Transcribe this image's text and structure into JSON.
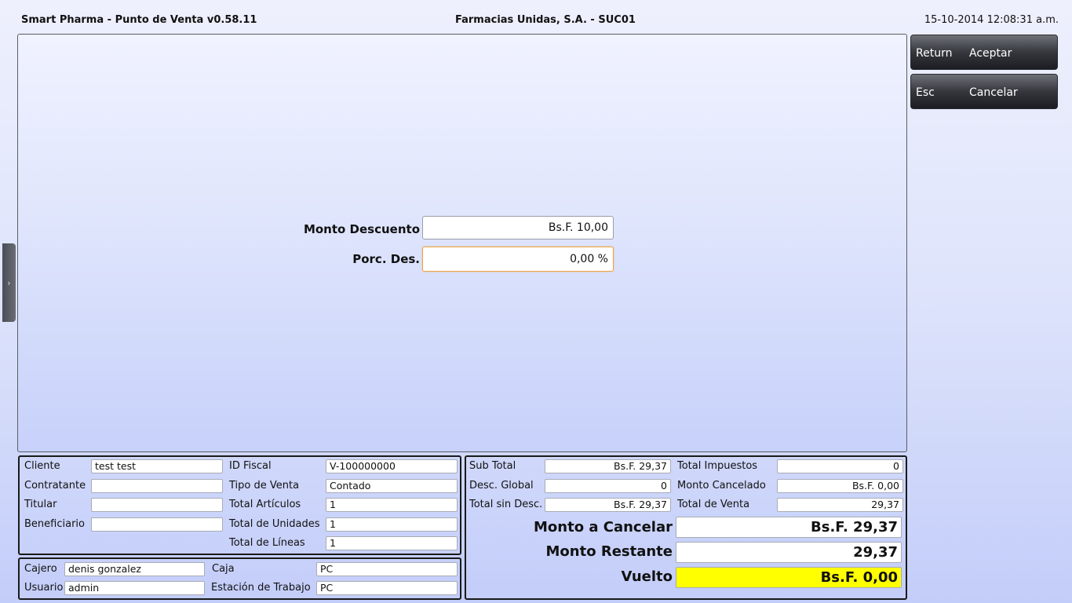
{
  "header": {
    "app_title": "Smart Pharma - Punto de Venta  v0.58.11",
    "company": "Farmacias Unidas, S.A.   -   SUC01",
    "datetime": "15-10-2014 12:08:31 a.m."
  },
  "discount_form": {
    "monto_label": "Monto Descuento",
    "monto_value": "Bs.F. 10,00",
    "porc_label": "Porc. Des.",
    "porc_value": "0,00 %"
  },
  "side_tab": {
    "icon": "chevron-right-icon",
    "glyph": "›"
  },
  "actions": [
    {
      "key": "Return",
      "label": "Aceptar"
    },
    {
      "key": "Esc",
      "label": "Cancelar"
    }
  ],
  "client_info": {
    "cliente_label": "Cliente",
    "cliente": "test test",
    "contratante_label": "Contratante",
    "contratante": "",
    "titular_label": "Titular",
    "titular": "",
    "beneficiario_label": "Beneficiario",
    "beneficiario": "",
    "id_fiscal_label": "ID Fiscal",
    "id_fiscal": "V-100000000",
    "tipo_venta_label": "Tipo de Venta",
    "tipo_venta": "Contado",
    "total_articulos_label": "Total Artículos",
    "total_articulos": "1",
    "total_unidades_label": "Total de Unidades",
    "total_unidades": "1",
    "total_lineas_label": "Total de Líneas",
    "total_lineas": "1"
  },
  "session_info": {
    "cajero_label": "Cajero",
    "cajero": "denis gonzalez",
    "usuario_label": "Usuario",
    "usuario": "admin",
    "caja_label": "Caja",
    "caja": "PC",
    "estacion_label": "Estación de Trabajo",
    "estacion": "PC"
  },
  "totals": {
    "sub_total_label": "Sub Total",
    "sub_total": "Bs.F. 29,37",
    "desc_global_label": "Desc. Global",
    "desc_global": "0",
    "total_sin_desc_label": "Total sin Desc.",
    "total_sin_desc": "Bs.F. 29,37",
    "total_impuestos_label": "Total Impuestos",
    "total_impuestos": "0",
    "monto_cancelado_label": "Monto Cancelado",
    "monto_cancelado": "Bs.F. 0,00",
    "total_venta_label": "Total de Venta",
    "total_venta": "29,37",
    "monto_a_cancelar_label": "Monto a Cancelar",
    "monto_a_cancelar": "Bs.F. 29,37",
    "monto_restante_label": "Monto Restante",
    "monto_restante": "29,37",
    "vuelto_label": "Vuelto",
    "vuelto": "Bs.F. 0,00",
    "vuelto_color": "#ffff00"
  }
}
